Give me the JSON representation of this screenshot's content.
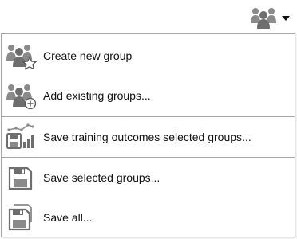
{
  "toolbar": {
    "groups_button_icon": "groups-icon",
    "dropdown_icon": "caret-down-icon"
  },
  "menu": {
    "items": [
      {
        "label": "Create new group",
        "icon": "group-star-icon"
      },
      {
        "label": "Add existing groups...",
        "icon": "group-add-icon"
      },
      {
        "label": "Save training outcomes selected groups...",
        "icon": "save-chart-icon"
      },
      {
        "label": "Save selected groups...",
        "icon": "save-icon"
      },
      {
        "label": "Save all...",
        "icon": "save-all-icon"
      }
    ]
  },
  "colors": {
    "icon_gray": "#8a8a8a",
    "icon_dark": "#6e6e6e",
    "border": "#a8a8a8",
    "text": "#111111"
  }
}
